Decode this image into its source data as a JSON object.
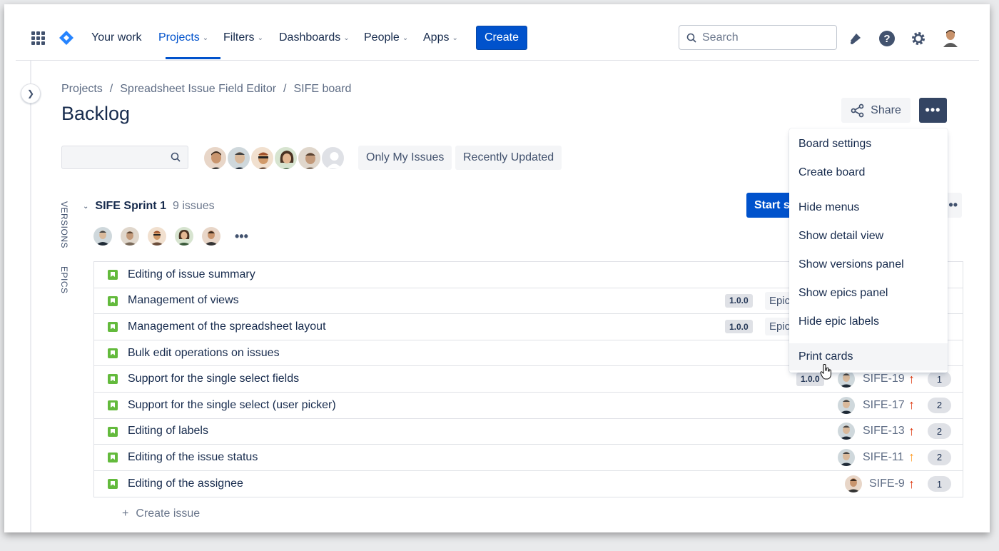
{
  "nav": {
    "items": [
      {
        "label": "Your work",
        "dropdown": false,
        "active": false
      },
      {
        "label": "Projects",
        "dropdown": true,
        "active": true
      },
      {
        "label": "Filters",
        "dropdown": true,
        "active": false
      },
      {
        "label": "Dashboards",
        "dropdown": true,
        "active": false
      },
      {
        "label": "People",
        "dropdown": true,
        "active": false
      },
      {
        "label": "Apps",
        "dropdown": true,
        "active": false
      }
    ],
    "create_label": "Create",
    "search_placeholder": "Search",
    "icons": [
      "app-switcher-icon",
      "jira-logo-icon",
      "notifications-icon",
      "help-icon",
      "settings-icon",
      "profile-avatar"
    ]
  },
  "breadcrumb": [
    "Projects",
    "Spreadsheet Issue Field Editor",
    "SIFE board"
  ],
  "page_title": "Backlog",
  "share_label": "Share",
  "quick_filters": [
    "Only My Issues",
    "Recently Updated"
  ],
  "side_tabs": [
    "VERSIONS",
    "EPICS"
  ],
  "sprint": {
    "name": "SIFE Sprint 1",
    "count": "9 issues",
    "start_label": "Start s"
  },
  "issues": [
    {
      "summary": "Editing of issue summary",
      "version": "",
      "epic": "",
      "key": "",
      "priority": "",
      "points": ""
    },
    {
      "summary": "Management of views",
      "version": "1.0.0",
      "epic": "Epic",
      "key": "",
      "priority": "",
      "points": ""
    },
    {
      "summary": "Management of the spreadsheet layout",
      "version": "1.0.0",
      "epic": "Epic",
      "key": "",
      "priority": "",
      "points": ""
    },
    {
      "summary": "Bulk edit operations on issues",
      "version": "",
      "epic": "",
      "key": "",
      "priority": "",
      "points": ""
    },
    {
      "summary": "Support for the single select fields",
      "version": "1.0.0",
      "epic": "",
      "key": "SIFE-19",
      "priority": "high",
      "points": "1"
    },
    {
      "summary": "Support for the single select (user picker)",
      "version": "",
      "epic": "",
      "key": "SIFE-17",
      "priority": "high",
      "points": "2"
    },
    {
      "summary": "Editing of labels",
      "version": "",
      "epic": "",
      "key": "SIFE-13",
      "priority": "high",
      "points": "2"
    },
    {
      "summary": "Editing of the issue status",
      "version": "",
      "epic": "",
      "key": "SIFE-11",
      "priority": "medium",
      "points": "2"
    },
    {
      "summary": "Editing of the assignee",
      "version": "",
      "epic": "",
      "key": "SIFE-9",
      "priority": "high",
      "points": "1"
    }
  ],
  "create_issue_label": "Create issue",
  "menu": {
    "items": [
      "Board settings",
      "Create board",
      "Hide menus",
      "Show detail view",
      "Show versions panel",
      "Show epics panel",
      "Hide epic labels",
      "Print cards"
    ],
    "hovered": "Print cards"
  },
  "colors": {
    "primary": "#0052cc",
    "priority_high": "#de350b",
    "priority_medium": "#ff991f",
    "story": "#63ba3c"
  }
}
